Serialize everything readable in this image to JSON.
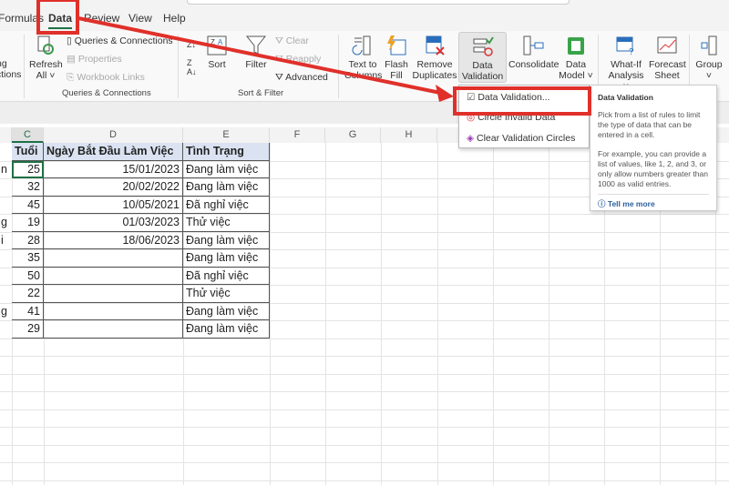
{
  "tabs": [
    "Formulas",
    "Data",
    "Review",
    "View",
    "Help"
  ],
  "ribbon": {
    "get_data_partial": [
      "ng",
      "ctions"
    ],
    "refresh": "Refresh",
    "refresh_sub": "All ˅",
    "queries": "Queries & Connections",
    "properties": "Properties",
    "workbook_links": "Workbook Links",
    "group_queries": "Queries & Connections",
    "sort": "Sort",
    "filter": "Filter",
    "clear": "Clear",
    "reapply": "Reapply",
    "advanced": "Advanced",
    "group_sort": "Sort & Filter",
    "text_to_columns": [
      "Text to",
      "Columns"
    ],
    "flash_fill": [
      "Flash",
      "Fill"
    ],
    "remove_duplicates": [
      "Remove",
      "Duplicates"
    ],
    "data_validation": [
      "Data",
      "Validation ˅"
    ],
    "consolidate": "Consolidate",
    "data_model": [
      "Data",
      "Model ˅"
    ],
    "what_if": [
      "What-If",
      "Analysis ˅"
    ],
    "forecast": [
      "Forecast",
      "Sheet"
    ],
    "group": [
      "Group",
      "˅"
    ]
  },
  "menu": {
    "items": [
      "Data Validation...",
      "Circle Invalid Data",
      "Clear Validation Circles"
    ]
  },
  "tooltip": {
    "title": "Data Validation",
    "p1": "Pick from a list of rules to limit the type of data that can be entered in a cell.",
    "p2": "For example, you can provide a list of values, like 1, 2, and 3, or only allow numbers greater than 1000 as valid entries.",
    "link": "Tell me more"
  },
  "columns": [
    "C",
    "D",
    "E",
    "F",
    "G",
    "H"
  ],
  "headers": [
    "Tuổi",
    "Ngày Bắt Đầu Làm Việc",
    "Tình Trạng"
  ],
  "rows": [
    {
      "b": "n",
      "age": "25",
      "date": "15/01/2023",
      "status": "Đang làm việc"
    },
    {
      "b": "",
      "age": "32",
      "date": "20/02/2022",
      "status": "Đang làm việc"
    },
    {
      "b": "",
      "age": "45",
      "date": "10/05/2021",
      "status": "Đã nghỉ việc"
    },
    {
      "b": "g",
      "age": "19",
      "date": "01/03/2023",
      "status": "Thử việc"
    },
    {
      "b": "i",
      "age": "28",
      "date": "18/06/2023",
      "status": "Đang làm việc"
    },
    {
      "b": "",
      "age": "35",
      "date": "",
      "status": "Đang làm việc"
    },
    {
      "b": "",
      "age": "50",
      "date": "",
      "status": "Đã nghỉ việc"
    },
    {
      "b": "",
      "age": "22",
      "date": "",
      "status": "Thử việc"
    },
    {
      "b": "g",
      "age": "41",
      "date": "",
      "status": "Đang làm việc"
    },
    {
      "b": "",
      "age": "29",
      "date": "",
      "status": "Đang làm việc"
    }
  ],
  "colors": {
    "accent": "#1e7145",
    "highlight": "#e0302a",
    "header_fill": "#dbe3f2"
  }
}
